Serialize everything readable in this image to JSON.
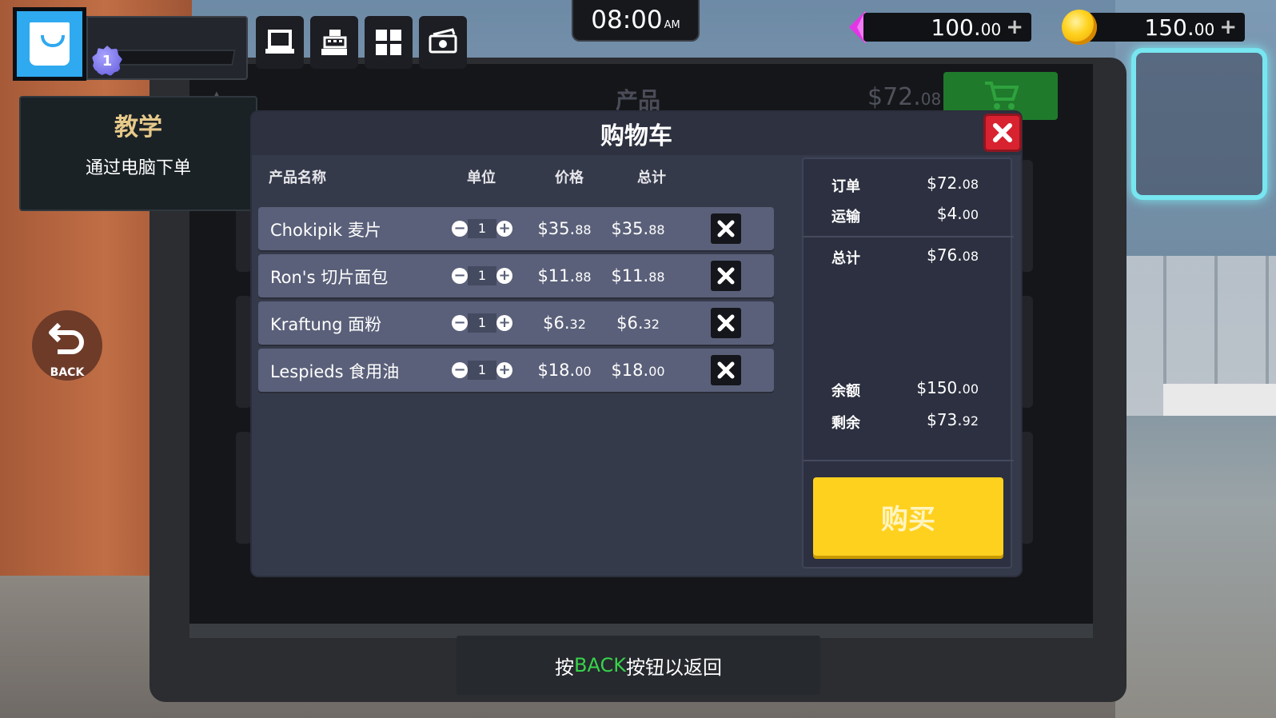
{
  "hud": {
    "level": "1",
    "clock": {
      "time": "08:00",
      "ampm": "AM"
    },
    "gems": {
      "whole": "100.",
      "cents": "00",
      "plus": "+"
    },
    "coins": {
      "whole": "150.",
      "cents": "00",
      "plus": "+"
    },
    "toolbar": [
      "computer-icon",
      "cash-register-icon",
      "grid-icon",
      "money-icon"
    ]
  },
  "tutorial": {
    "title": "教学",
    "description": "通过电脑下单"
  },
  "back_button": {
    "label": "BACK"
  },
  "background_page": {
    "header_label": "产品",
    "price_whole": "$72.",
    "price_cents": "08"
  },
  "cart": {
    "title": "购物车",
    "columns": {
      "name": "产品名称",
      "unit": "单位",
      "price": "价格",
      "total": "总计"
    },
    "items": [
      {
        "name": "Chokipik 麦片",
        "qty": "1",
        "price_whole": "$35.",
        "price_cents": "88",
        "total_whole": "$35.",
        "total_cents": "88"
      },
      {
        "name": "Ron's 切片面包",
        "qty": "1",
        "price_whole": "$11.",
        "price_cents": "88",
        "total_whole": "$11.",
        "total_cents": "88"
      },
      {
        "name": "Kraftung 面粉",
        "qty": "1",
        "price_whole": "$6.",
        "price_cents": "32",
        "total_whole": "$6.",
        "total_cents": "32"
      },
      {
        "name": "Lespieds 食用油",
        "qty": "1",
        "price_whole": "$18.",
        "price_cents": "00",
        "total_whole": "$18.",
        "total_cents": "00"
      }
    ],
    "summary": {
      "order_label": "订单",
      "order_whole": "$72.",
      "order_cents": "08",
      "shipping_label": "运输",
      "shipping_whole": "$4.",
      "shipping_cents": "00",
      "total_label": "总计",
      "total_whole": "$76.",
      "total_cents": "08",
      "balance_label": "余额",
      "balance_whole": "$150.",
      "balance_cents": "00",
      "remaining_label": "剩余",
      "remaining_whole": "$73.",
      "remaining_cents": "92"
    },
    "buy_label": "购买"
  },
  "hint": {
    "prefix": "按",
    "key": "BACK",
    "suffix": "按钮以返回"
  },
  "colors": {
    "buy_button": "#ffd11f",
    "close_button": "#d8222f",
    "row_bg": "#5a6079",
    "hint_key": "#38d24b",
    "tutorial_title": "#e6c98a"
  }
}
